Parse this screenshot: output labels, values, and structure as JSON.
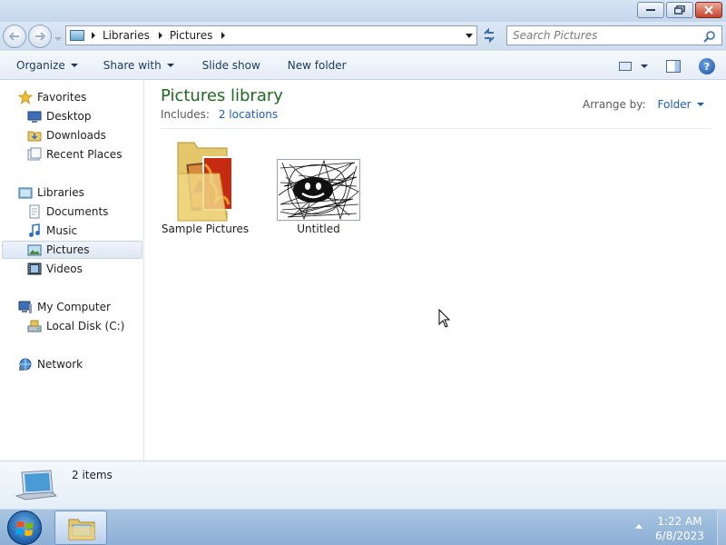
{
  "window": {
    "buttons": [
      "minimize",
      "maximize",
      "close"
    ]
  },
  "address": {
    "crumbs": [
      "Libraries",
      "Pictures"
    ],
    "search_placeholder": "Search Pictures"
  },
  "toolbar": {
    "organize": "Organize",
    "share_with": "Share with",
    "slide_show": "Slide show",
    "new_folder": "New folder"
  },
  "nav": {
    "favorites": "Favorites",
    "desktop": "Desktop",
    "downloads": "Downloads",
    "recent_places": "Recent Places",
    "libraries": "Libraries",
    "documents": "Documents",
    "music": "Music",
    "pictures": "Pictures",
    "videos": "Videos",
    "my_computer": "My Computer",
    "local_disk": "Local Disk (C:)",
    "network": "Network",
    "selected": "Pictures"
  },
  "library": {
    "title": "Pictures library",
    "includes_label": "Includes:",
    "includes_link": "2 locations",
    "arrange_label": "Arrange by:",
    "arrange_value": "Folder"
  },
  "files": [
    {
      "label": "Sample Pictures",
      "type": "folder"
    },
    {
      "label": "Untitled",
      "type": "image"
    }
  ],
  "details": {
    "count": "2 items"
  },
  "taskbar": {
    "time": "1:22 AM",
    "date": "6/8/2023"
  },
  "colors": {
    "title_green": "#1e6a1e",
    "link_blue": "#1a5fb4"
  }
}
